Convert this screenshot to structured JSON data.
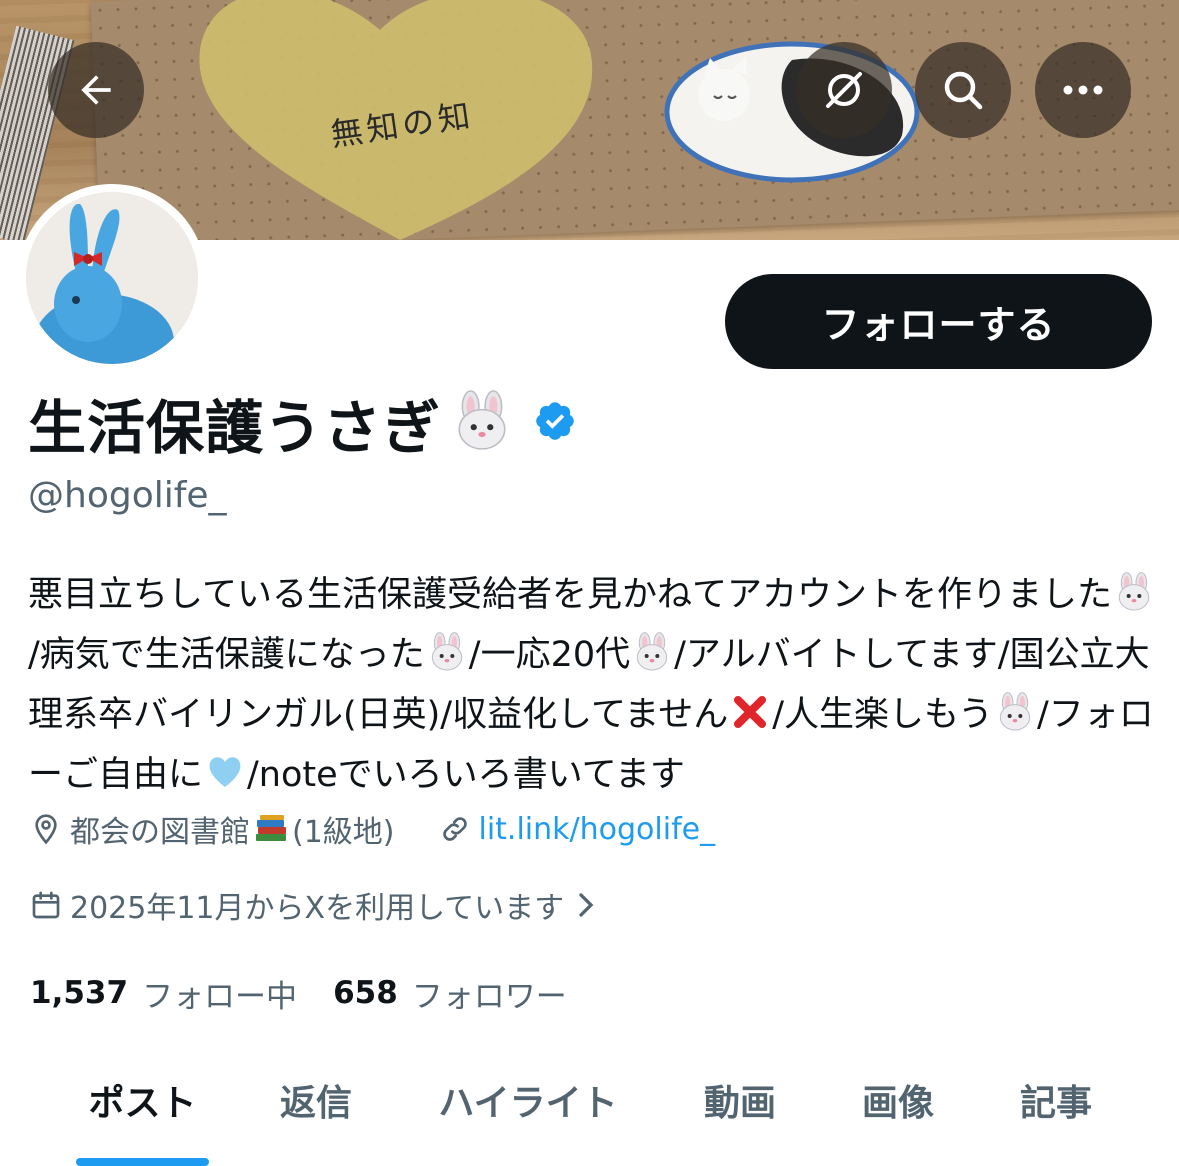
{
  "banner": {
    "handwriting": "無知の知"
  },
  "header": {
    "back_icon": "arrow-left-icon",
    "grok_icon": "grok-icon",
    "search_icon": "search-icon",
    "more_icon": "more-horizontal-icon"
  },
  "profile": {
    "display_name": "生活保護うさぎ",
    "name_emoji": "rabbit-face-emoji",
    "verified": true,
    "handle": "@hogolife_",
    "follow_label": "フォローする",
    "bio": [
      {
        "t": "text",
        "v": "悪目立ちしている生活保護受給者を見かねてアカウントを作りました"
      },
      {
        "t": "emoji",
        "v": "rabbit"
      },
      {
        "t": "text",
        "v": "/病気で生活保護になった"
      },
      {
        "t": "emoji",
        "v": "rabbit"
      },
      {
        "t": "text",
        "v": "/一応20代"
      },
      {
        "t": "emoji",
        "v": "rabbit"
      },
      {
        "t": "text",
        "v": "/アルバイトしてます/国公立大理系卒バイリンガル(日英)/収益化してません"
      },
      {
        "t": "emoji",
        "v": "cross"
      },
      {
        "t": "text",
        "v": "/人生楽しもう"
      },
      {
        "t": "emoji",
        "v": "rabbit"
      },
      {
        "t": "text",
        "v": "/フォローご自由に"
      },
      {
        "t": "emoji",
        "v": "heart"
      },
      {
        "t": "text",
        "v": "/noteでいろいろ書いてます"
      }
    ],
    "location": "都会の図書館",
    "location_suffix": "(1級地)",
    "link": "lit.link/hogolife_",
    "joined": "2025年11月からXを利用しています"
  },
  "stats": {
    "following_count": "1,537",
    "following_label": "フォロー中",
    "followers_count": "658",
    "followers_label": "フォロワー"
  },
  "tabs": [
    {
      "label": "ポスト",
      "active": true
    },
    {
      "label": "返信",
      "active": false
    },
    {
      "label": "ハイライト",
      "active": false
    },
    {
      "label": "動画",
      "active": false
    },
    {
      "label": "画像",
      "active": false
    },
    {
      "label": "記事",
      "active": false
    }
  ],
  "colors": {
    "accent": "#1d9bf0",
    "text_primary": "#0f1419",
    "text_secondary": "#536471",
    "button_dark": "#0f1419"
  }
}
